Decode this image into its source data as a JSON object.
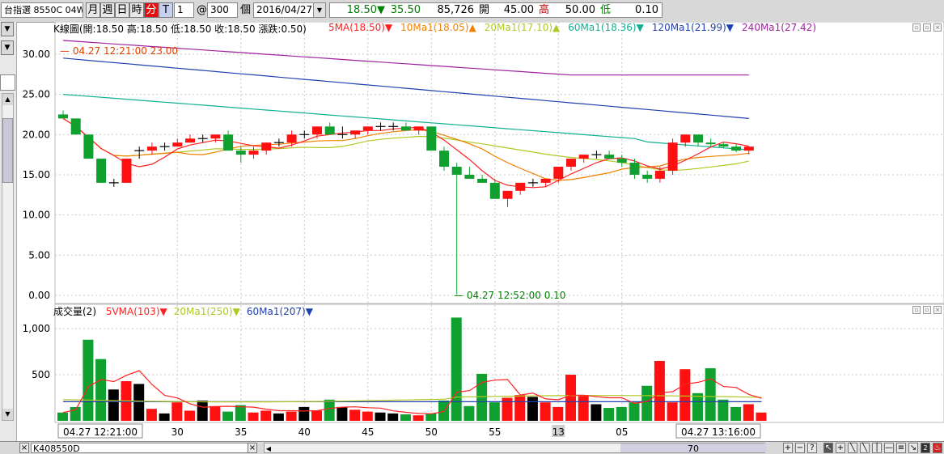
{
  "toolbar": {
    "symbol": "台指選 8550C 04W4",
    "period_buttons": [
      "月",
      "週",
      "日",
      "時",
      "分",
      "T"
    ],
    "active_period": "分",
    "interval": "1",
    "at_sign": "@",
    "count": "300",
    "count_unit": "個",
    "date": "2016/04/27",
    "last_price": "18.50",
    "change_arrow": "▼",
    "change": "35.50",
    "volume": "85,726",
    "open_label": "開",
    "open": "45.00",
    "high_label": "高",
    "high": "50.00",
    "low_label": "低",
    "low": "0.10"
  },
  "price_panel": {
    "ohlc_text": "K線圖(開:18.50 高:18.50 低:18.50 收:18.50 漲跌:0.50)",
    "ma_legends": [
      {
        "text": "5MA(18.50)",
        "arrow": "▼",
        "color": "#ff2020"
      },
      {
        "text": "10Ma1(18.05)",
        "arrow": "▲",
        "color": "#f08000"
      },
      {
        "text": "20Ma1(17.10)",
        "arrow": "▲",
        "color": "#b0c820"
      },
      {
        "text": "60Ma1(18.36)",
        "arrow": "▼",
        "color": "#10b090"
      },
      {
        "text": "120Ma1(21.99)",
        "arrow": "▼",
        "color": "#2040b0"
      },
      {
        "text": "240Ma1(27.42)",
        "arrow": "",
        "color": "#a020a0"
      }
    ],
    "high_annotation": "04.27 12:21:00  23.00",
    "low_annotation": "04.27 12:52:00  0.10",
    "y_labels": [
      "30.00",
      "25.00",
      "20.00",
      "15.00",
      "10.00",
      "5.00",
      "0.00"
    ]
  },
  "volume_panel": {
    "title": "成交量(2)",
    "legends": [
      {
        "text": "5VMA(103)",
        "arrow": "▼",
        "color": "#ff2020"
      },
      {
        "text": "20Ma1(250)",
        "arrow": "▼",
        "color": "#b0c820"
      },
      {
        "text": "60Ma1(207)",
        "arrow": "▼",
        "color": "#2040b0"
      }
    ],
    "y_labels": [
      "1,000",
      "500"
    ]
  },
  "x_axis": {
    "start_label": "04.27 12:21:00",
    "end_label": "04.27 13:16:00",
    "ticks": [
      "30",
      "35",
      "40",
      "45",
      "50",
      "55",
      "13",
      "05"
    ]
  },
  "bottom_bar": {
    "tab_label": "K408550D",
    "close_glyph": "×",
    "scroll_value": "70"
  },
  "chart_data": {
    "type": "candlestick",
    "x": [
      "12:21",
      "12:22",
      "12:23",
      "12:24",
      "12:25",
      "12:26",
      "12:27",
      "12:28",
      "12:29",
      "12:30",
      "12:31",
      "12:32",
      "12:33",
      "12:34",
      "12:35",
      "12:36",
      "12:37",
      "12:38",
      "12:39",
      "12:40",
      "12:41",
      "12:42",
      "12:43",
      "12:44",
      "12:45",
      "12:46",
      "12:47",
      "12:48",
      "12:49",
      "12:50",
      "12:51",
      "12:52",
      "12:53",
      "12:54",
      "12:55",
      "12:56",
      "12:57",
      "12:58",
      "12:59",
      "13:00",
      "13:01",
      "13:02",
      "13:03",
      "13:04",
      "13:05",
      "13:06",
      "13:07",
      "13:08",
      "13:09",
      "13:10",
      "13:11",
      "13:12",
      "13:13",
      "13:14",
      "13:15",
      "13:16"
    ],
    "open": [
      22.5,
      22,
      20,
      17,
      14,
      14,
      18,
      18,
      18.5,
      18.5,
      19,
      19.5,
      19.5,
      20,
      18,
      17.5,
      18,
      19,
      19,
      20,
      20,
      21,
      20,
      20,
      20.5,
      21,
      21,
      21,
      20.5,
      21,
      18,
      16,
      15,
      14.5,
      14,
      12,
      13,
      14,
      14,
      14.5,
      16,
      17,
      17.5,
      17.5,
      17,
      16.5,
      15,
      14.5,
      15.5,
      19,
      20,
      19,
      18.8,
      18.5,
      18
    ],
    "high": [
      23,
      22,
      20,
      17,
      14.5,
      17,
      18.5,
      19,
      19,
      19.5,
      20,
      20,
      20,
      20.5,
      18.5,
      18.5,
      19,
      19.5,
      20.5,
      20.5,
      21,
      21.5,
      21,
      20.5,
      21,
      21.5,
      21.5,
      21.5,
      21,
      21,
      18.5,
      16.5,
      16,
      15,
      14.5,
      13,
      14,
      14.5,
      14.5,
      16,
      17,
      17.5,
      18,
      18,
      17.5,
      17,
      15.5,
      16,
      19.5,
      20,
      20,
      19.5,
      19,
      18.8,
      18.5
    ],
    "low": [
      22,
      20,
      17,
      14,
      13.5,
      14,
      17,
      17.5,
      18,
      18.5,
      19,
      19,
      19,
      18.5,
      16.5,
      17,
      17.5,
      18.5,
      18.5,
      19.5,
      19.5,
      20.5,
      19.5,
      19.5,
      20,
      20.5,
      20.5,
      20.5,
      20,
      18,
      15.5,
      0.1,
      14.5,
      14,
      12,
      11,
      12.5,
      13.5,
      13.5,
      14,
      15.5,
      16.5,
      17,
      17,
      16,
      14.5,
      14,
      14,
      15,
      18.5,
      18.5,
      18.5,
      18.3,
      17.8,
      17.5
    ],
    "close": [
      22,
      20,
      17,
      14,
      14,
      17,
      18,
      18.5,
      18.5,
      19,
      19.5,
      19.5,
      20,
      18,
      17.5,
      18,
      19,
      19,
      20,
      20,
      21,
      20,
      20,
      20.5,
      21,
      21,
      21,
      20.5,
      21,
      18,
      16,
      15,
      14.5,
      14,
      12,
      13,
      14,
      14,
      14.5,
      16,
      17,
      17.5,
      17.5,
      17,
      16.5,
      15,
      14.5,
      15.5,
      19,
      20,
      19,
      18.8,
      18.5,
      18,
      18.5
    ],
    "volume": [
      90,
      150,
      880,
      670,
      340,
      430,
      400,
      130,
      80,
      200,
      110,
      220,
      160,
      100,
      170,
      90,
      110,
      80,
      100,
      150,
      110,
      230,
      150,
      120,
      100,
      90,
      80,
      70,
      60,
      80,
      220,
      1120,
      160,
      510,
      200,
      250,
      280,
      260,
      200,
      150,
      500,
      280,
      180,
      140,
      150,
      200,
      380,
      650,
      200,
      560,
      300,
      570,
      230,
      150,
      180,
      90,
      20
    ],
    "ylim_price": [
      0,
      32
    ],
    "ylim_volume": [
      0,
      1150
    ]
  }
}
